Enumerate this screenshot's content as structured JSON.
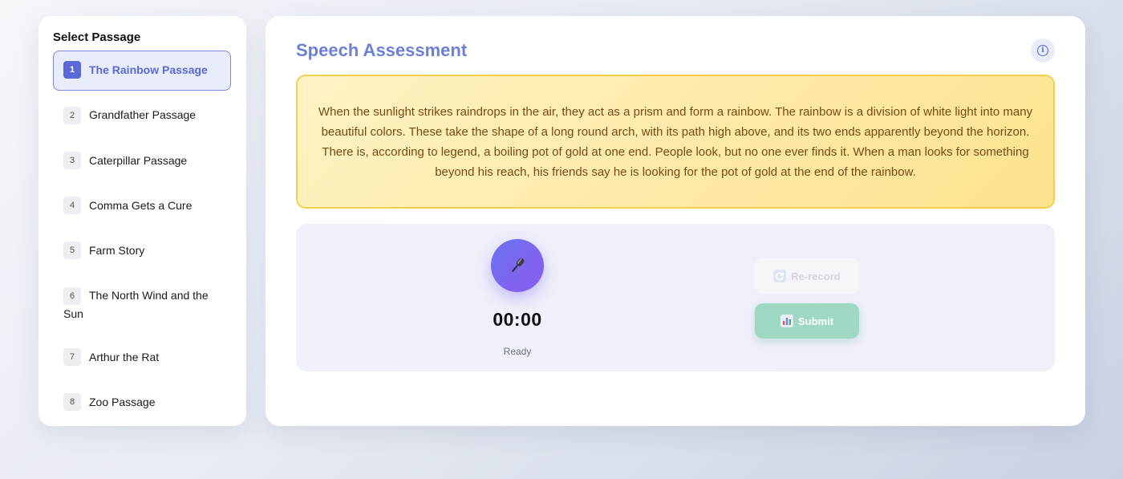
{
  "sidebar": {
    "title": "Select Passage",
    "items": [
      {
        "num": "1",
        "label": "The Rainbow Passage",
        "active": true
      },
      {
        "num": "2",
        "label": "Grandfather Passage"
      },
      {
        "num": "3",
        "label": "Caterpillar Passage"
      },
      {
        "num": "4",
        "label": "Comma Gets a Cure"
      },
      {
        "num": "5",
        "label": "Farm Story"
      },
      {
        "num": "6",
        "label": "The North Wind and the Sun"
      },
      {
        "num": "7",
        "label": "Arthur the Rat"
      },
      {
        "num": "8",
        "label": "Zoo Passage"
      }
    ]
  },
  "main": {
    "title": "Speech Assessment",
    "info_icon": "info-icon",
    "passage_text": "When the sunlight strikes raindrops in the air, they act as a prism and form a rainbow. The rainbow is a division of white light into many beautiful colors. These take the shape of a long round arch, with its path high above, and its two ends apparently beyond the horizon. There is, according to legend, a boiling pot of gold at one end. People look, but no one ever finds it. When a man looks for something beyond his reach, his friends say he is looking for the pot of gold at the end of the rainbow."
  },
  "recorder": {
    "mic_icon": "microphone-icon",
    "timer": "00:00",
    "status": "Ready",
    "rerecord_label": "Re-record",
    "rerecord_icon": "refresh-icon",
    "submit_label": "Submit",
    "submit_icon": "bar-chart-icon"
  },
  "colors": {
    "accent": "#5a68d8",
    "title": "#6b7fd7",
    "passage_bg": "#fde9a4",
    "passage_border": "#f4cf4c",
    "passage_text": "#7a4a12",
    "mic": "#7467f0",
    "submit": "#9ed8c3"
  }
}
